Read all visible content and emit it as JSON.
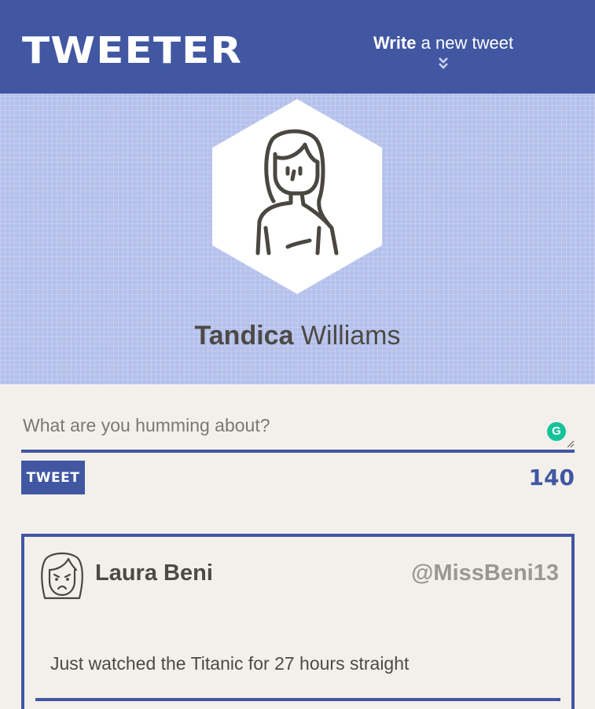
{
  "header": {
    "brand": "TWEETER",
    "compose_toggle": {
      "bold": "Write",
      "rest": " a new tweet",
      "icon": "double-chevron-down-icon"
    }
  },
  "profile": {
    "avatar_icon": "woman-avatar-icon",
    "first_name": "Tandica",
    "last_name": "Williams"
  },
  "composer": {
    "placeholder": "What are you humming about?",
    "value": "",
    "grammarly_icon": "grammarly-icon",
    "grammarly_glyph": "G",
    "submit_label": "TWEET",
    "char_count": "140"
  },
  "tweets": [
    {
      "avatar_icon": "frowning-woman-avatar-icon",
      "name": "Laura Beni",
      "handle": "@MissBeni13",
      "text": "Just watched the Titanic for 27 hours straight"
    }
  ],
  "colors": {
    "primary": "#4157a2",
    "hero_bg": "#b5c1ec",
    "page_bg": "#f3f0ec",
    "text": "#4d4a45",
    "muted": "#9a9792",
    "grammarly": "#15c39a"
  }
}
